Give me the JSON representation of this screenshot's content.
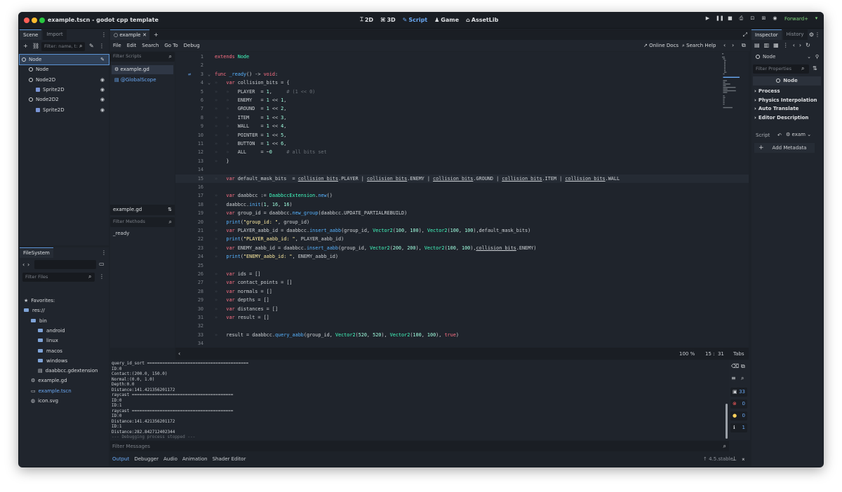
{
  "window": {
    "title": "example.tscn - godot cpp template"
  },
  "modes": [
    "2D",
    "3D",
    "Script",
    "Game",
    "AssetLib"
  ],
  "renderer": "Forward+",
  "scene_dock": {
    "tabs": [
      "Scene",
      "Import"
    ],
    "filter_placeholder": "Filter: name, t:",
    "nodes": [
      {
        "label": "Node",
        "depth": 0,
        "type": "node",
        "selected": true
      },
      {
        "label": "Node",
        "depth": 1,
        "type": "node"
      },
      {
        "label": "Node2D",
        "depth": 1,
        "type": "node",
        "visible": true
      },
      {
        "label": "Sprite2D",
        "depth": 2,
        "type": "sprite",
        "visible": true
      },
      {
        "label": "Node2D2",
        "depth": 1,
        "type": "node",
        "visible": true
      },
      {
        "label": "Sprite2D",
        "depth": 2,
        "type": "sprite",
        "visible": true
      }
    ]
  },
  "filesystem": {
    "tab": "FileSystem",
    "filter_placeholder": "Filter Files",
    "items": [
      {
        "label": "Favorites:",
        "depth": 0,
        "kind": "star"
      },
      {
        "label": "res://",
        "depth": 0,
        "kind": "folder"
      },
      {
        "label": "bin",
        "depth": 1,
        "kind": "folder"
      },
      {
        "label": "android",
        "depth": 2,
        "kind": "folder"
      },
      {
        "label": "linux",
        "depth": 2,
        "kind": "folder"
      },
      {
        "label": "macos",
        "depth": 2,
        "kind": "folder"
      },
      {
        "label": "windows",
        "depth": 2,
        "kind": "folder"
      },
      {
        "label": "daabbcc.gdextension",
        "depth": 2,
        "kind": "file"
      },
      {
        "label": "example.gd",
        "depth": 1,
        "kind": "gear"
      },
      {
        "label": "example.tscn",
        "depth": 1,
        "kind": "scene",
        "active": true
      },
      {
        "label": "icon.svg",
        "depth": 1,
        "kind": "image"
      }
    ]
  },
  "editor": {
    "tab": "example",
    "menus": [
      "File",
      "Edit",
      "Search",
      "Go To",
      "Debug"
    ],
    "online_docs": "Online Docs",
    "search_help": "Search Help",
    "filter_scripts": "Filter Scripts",
    "scripts": [
      "example.gd",
      "@GlobalScope"
    ],
    "current_file": "example.gd",
    "filter_methods": "Filter Methods",
    "methods": [
      "_ready"
    ],
    "zoom": "100 %",
    "position": "15 :  31",
    "indent": "Tabs"
  },
  "code_lines": [
    "extends Node",
    "",
    "func _ready() -> void:",
    "\tvar collision_bits = {",
    "\t\tPLAYER  = 1,     # (1 << 0)",
    "\t\tENEMY   = 1 << 1,",
    "\t\tGROUND  = 1 << 2,",
    "\t\tITEM    = 1 << 3,",
    "\t\tWALL    = 1 << 4,",
    "\t\tPOINTER = 1 << 5,",
    "\t\tBUTTON  = 1 << 6,",
    "\t\tALL     = ~0     # all bits set",
    "\t}",
    "",
    "\tvar default_mask_bits  = collision_bits.PLAYER | collision_bits.ENEMY | collision_bits.GROUND | collision_bits.ITEM | collision_bits.WALL",
    "",
    "\tvar daabbcc := DaabbccExtension.new()",
    "\tdaabbcc.init(1, 16, 16)",
    "\tvar group_id = daabbcc.new_group(daabbcc.UPDATE_PARTIALREBUILD)",
    "\tprint(\"group_id: \", group_id)",
    "\tvar PLAYER_aabb_id = daabbcc.insert_aabb(group_id, Vector2(100, 100), Vector2(100, 100),default_mask_bits)",
    "\tprint(\"PLAYER_aabb_id: \", PLAYER_aabb_id)",
    "\tvar ENEMY_aabb_id = daabbcc.insert_aabb(group_id, Vector2(200, 200), Vector2(100, 100),collision_bits.ENEMY)",
    "\tprint(\"ENEMY_aabb_id: \", ENEMY_aabb_id)",
    "",
    "\tvar ids = []",
    "\tvar contact_points = []",
    "\tvar normals = []",
    "\tvar depths = []",
    "\tvar distances = []",
    "\tvar result = []",
    "",
    "\tresult = daabbcc.query_aabb(group_id, Vector2(520, 520), Vector2(100, 100), true)",
    ""
  ],
  "output": {
    "lines": [
      "query_id_sort ========================================",
      "ID:0",
      "Contact:(200.0, 150.0)",
      "Normal:(0.0, 1.0)",
      "Depth:0.0",
      "Distance:141.421356201172",
      "raycast ========================================",
      "ID:0",
      "ID:1",
      "raycast ========================================",
      "ID:0",
      "Distance:141.421356201172",
      "ID:1",
      "Distance:282.842712402344",
      "--- Debugging process stopped ---"
    ],
    "filter_placeholder": "Filter Messages",
    "counts": [
      "33",
      "0",
      "0",
      "1"
    ]
  },
  "bottom_tabs": [
    "Output",
    "Debugger",
    "Audio",
    "Animation",
    "Shader Editor"
  ],
  "version": "4.5.stable",
  "inspector": {
    "tabs": [
      "Inspector",
      "History"
    ],
    "node_selector": "Node",
    "filter_placeholder": "Filter Properties",
    "header": "Node",
    "sections": [
      "Process",
      "Physics Interpolation",
      "Auto Translate",
      "Editor Description"
    ],
    "script_label": "Script",
    "script_value": "exam",
    "add_metadata": "Add Metadata"
  },
  "colors": {
    "accent": "#5b93d4",
    "keyword": "#ff7185",
    "function": "#57b3ff",
    "string": "#ffeda1",
    "number": "#a1ffe0"
  }
}
